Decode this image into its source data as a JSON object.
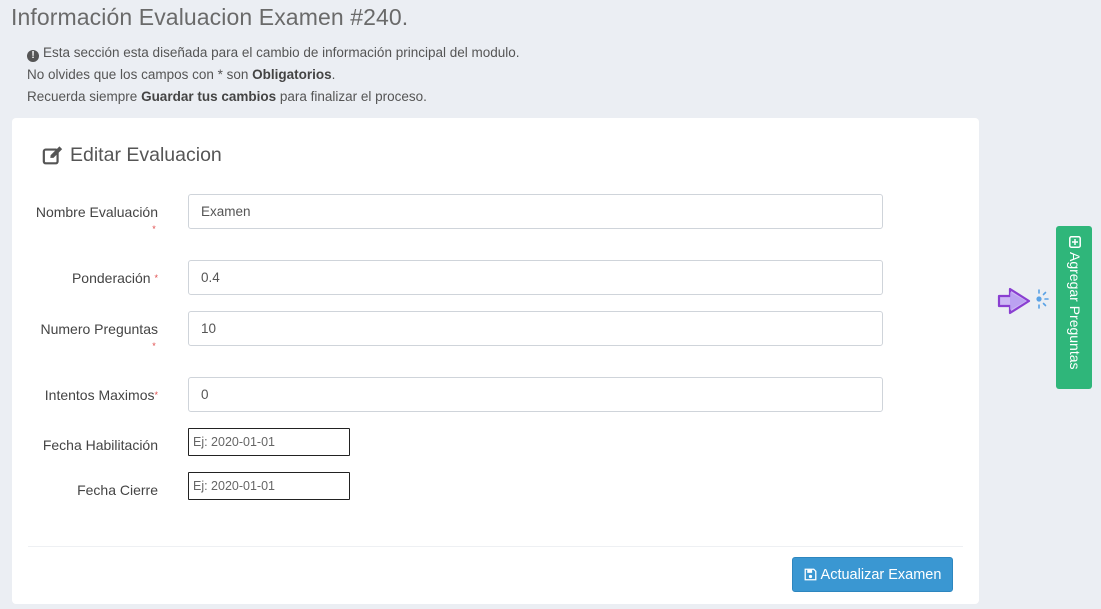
{
  "page": {
    "title": "Información Evaluacion Examen #240.",
    "info": {
      "line1": "Esta sección esta diseñada para el cambio de información principal del modulo.",
      "line2_pre": "No olvides que los campos con * son ",
      "line2_bold": "Obligatorios",
      "line2_post": ".",
      "line3_pre": "Recuerda siempre ",
      "line3_bold": "Guardar tus cambios",
      "line3_post": " para finalizar el proceso."
    }
  },
  "form": {
    "title": "Editar Evaluacion",
    "required_mark": "*",
    "fields": {
      "nombre": {
        "label": "Nombre Evaluación",
        "value": "Examen"
      },
      "ponderacion": {
        "label": "Ponderación",
        "value": "0.4"
      },
      "numero_preguntas": {
        "label": "Numero Preguntas",
        "value": "10"
      },
      "intentos": {
        "label": "Intentos Maximos",
        "value": "0"
      },
      "fecha_habilitacion": {
        "label": "Fecha Habilitación",
        "placeholder": "Ej: 2020-01-01"
      },
      "fecha_cierre": {
        "label": "Fecha Cierre",
        "placeholder": "Ej: 2020-01-01"
      }
    },
    "submit_label": "Actualizar Examen"
  },
  "side_tab": {
    "label": "Agregar Preguntas"
  },
  "icons": {
    "info": "info-circle-icon",
    "edit": "edit-icon",
    "save": "floppy-disk-icon",
    "add": "plus-square-icon",
    "pointer": "pointer-arrow-icon"
  },
  "colors": {
    "background": "#ebeef3",
    "button_primary": "#3a97d2",
    "side_tab": "#2fb67a",
    "required": "#e04b4b",
    "pointer": "#8a3fd1"
  }
}
